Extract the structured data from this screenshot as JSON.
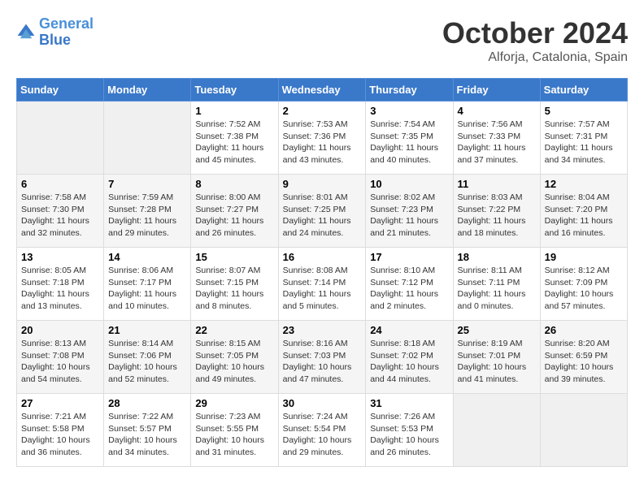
{
  "header": {
    "logo_general": "General",
    "logo_blue": "Blue",
    "month": "October 2024",
    "location": "Alforja, Catalonia, Spain"
  },
  "days_of_week": [
    "Sunday",
    "Monday",
    "Tuesday",
    "Wednesday",
    "Thursday",
    "Friday",
    "Saturday"
  ],
  "weeks": [
    [
      {
        "day": "",
        "sunrise": "",
        "sunset": "",
        "daylight": ""
      },
      {
        "day": "",
        "sunrise": "",
        "sunset": "",
        "daylight": ""
      },
      {
        "day": "1",
        "sunrise": "Sunrise: 7:52 AM",
        "sunset": "Sunset: 7:38 PM",
        "daylight": "Daylight: 11 hours and 45 minutes."
      },
      {
        "day": "2",
        "sunrise": "Sunrise: 7:53 AM",
        "sunset": "Sunset: 7:36 PM",
        "daylight": "Daylight: 11 hours and 43 minutes."
      },
      {
        "day": "3",
        "sunrise": "Sunrise: 7:54 AM",
        "sunset": "Sunset: 7:35 PM",
        "daylight": "Daylight: 11 hours and 40 minutes."
      },
      {
        "day": "4",
        "sunrise": "Sunrise: 7:56 AM",
        "sunset": "Sunset: 7:33 PM",
        "daylight": "Daylight: 11 hours and 37 minutes."
      },
      {
        "day": "5",
        "sunrise": "Sunrise: 7:57 AM",
        "sunset": "Sunset: 7:31 PM",
        "daylight": "Daylight: 11 hours and 34 minutes."
      }
    ],
    [
      {
        "day": "6",
        "sunrise": "Sunrise: 7:58 AM",
        "sunset": "Sunset: 7:30 PM",
        "daylight": "Daylight: 11 hours and 32 minutes."
      },
      {
        "day": "7",
        "sunrise": "Sunrise: 7:59 AM",
        "sunset": "Sunset: 7:28 PM",
        "daylight": "Daylight: 11 hours and 29 minutes."
      },
      {
        "day": "8",
        "sunrise": "Sunrise: 8:00 AM",
        "sunset": "Sunset: 7:27 PM",
        "daylight": "Daylight: 11 hours and 26 minutes."
      },
      {
        "day": "9",
        "sunrise": "Sunrise: 8:01 AM",
        "sunset": "Sunset: 7:25 PM",
        "daylight": "Daylight: 11 hours and 24 minutes."
      },
      {
        "day": "10",
        "sunrise": "Sunrise: 8:02 AM",
        "sunset": "Sunset: 7:23 PM",
        "daylight": "Daylight: 11 hours and 21 minutes."
      },
      {
        "day": "11",
        "sunrise": "Sunrise: 8:03 AM",
        "sunset": "Sunset: 7:22 PM",
        "daylight": "Daylight: 11 hours and 18 minutes."
      },
      {
        "day": "12",
        "sunrise": "Sunrise: 8:04 AM",
        "sunset": "Sunset: 7:20 PM",
        "daylight": "Daylight: 11 hours and 16 minutes."
      }
    ],
    [
      {
        "day": "13",
        "sunrise": "Sunrise: 8:05 AM",
        "sunset": "Sunset: 7:18 PM",
        "daylight": "Daylight: 11 hours and 13 minutes."
      },
      {
        "day": "14",
        "sunrise": "Sunrise: 8:06 AM",
        "sunset": "Sunset: 7:17 PM",
        "daylight": "Daylight: 11 hours and 10 minutes."
      },
      {
        "day": "15",
        "sunrise": "Sunrise: 8:07 AM",
        "sunset": "Sunset: 7:15 PM",
        "daylight": "Daylight: 11 hours and 8 minutes."
      },
      {
        "day": "16",
        "sunrise": "Sunrise: 8:08 AM",
        "sunset": "Sunset: 7:14 PM",
        "daylight": "Daylight: 11 hours and 5 minutes."
      },
      {
        "day": "17",
        "sunrise": "Sunrise: 8:10 AM",
        "sunset": "Sunset: 7:12 PM",
        "daylight": "Daylight: 11 hours and 2 minutes."
      },
      {
        "day": "18",
        "sunrise": "Sunrise: 8:11 AM",
        "sunset": "Sunset: 7:11 PM",
        "daylight": "Daylight: 11 hours and 0 minutes."
      },
      {
        "day": "19",
        "sunrise": "Sunrise: 8:12 AM",
        "sunset": "Sunset: 7:09 PM",
        "daylight": "Daylight: 10 hours and 57 minutes."
      }
    ],
    [
      {
        "day": "20",
        "sunrise": "Sunrise: 8:13 AM",
        "sunset": "Sunset: 7:08 PM",
        "daylight": "Daylight: 10 hours and 54 minutes."
      },
      {
        "day": "21",
        "sunrise": "Sunrise: 8:14 AM",
        "sunset": "Sunset: 7:06 PM",
        "daylight": "Daylight: 10 hours and 52 minutes."
      },
      {
        "day": "22",
        "sunrise": "Sunrise: 8:15 AM",
        "sunset": "Sunset: 7:05 PM",
        "daylight": "Daylight: 10 hours and 49 minutes."
      },
      {
        "day": "23",
        "sunrise": "Sunrise: 8:16 AM",
        "sunset": "Sunset: 7:03 PM",
        "daylight": "Daylight: 10 hours and 47 minutes."
      },
      {
        "day": "24",
        "sunrise": "Sunrise: 8:18 AM",
        "sunset": "Sunset: 7:02 PM",
        "daylight": "Daylight: 10 hours and 44 minutes."
      },
      {
        "day": "25",
        "sunrise": "Sunrise: 8:19 AM",
        "sunset": "Sunset: 7:01 PM",
        "daylight": "Daylight: 10 hours and 41 minutes."
      },
      {
        "day": "26",
        "sunrise": "Sunrise: 8:20 AM",
        "sunset": "Sunset: 6:59 PM",
        "daylight": "Daylight: 10 hours and 39 minutes."
      }
    ],
    [
      {
        "day": "27",
        "sunrise": "Sunrise: 7:21 AM",
        "sunset": "Sunset: 5:58 PM",
        "daylight": "Daylight: 10 hours and 36 minutes."
      },
      {
        "day": "28",
        "sunrise": "Sunrise: 7:22 AM",
        "sunset": "Sunset: 5:57 PM",
        "daylight": "Daylight: 10 hours and 34 minutes."
      },
      {
        "day": "29",
        "sunrise": "Sunrise: 7:23 AM",
        "sunset": "Sunset: 5:55 PM",
        "daylight": "Daylight: 10 hours and 31 minutes."
      },
      {
        "day": "30",
        "sunrise": "Sunrise: 7:24 AM",
        "sunset": "Sunset: 5:54 PM",
        "daylight": "Daylight: 10 hours and 29 minutes."
      },
      {
        "day": "31",
        "sunrise": "Sunrise: 7:26 AM",
        "sunset": "Sunset: 5:53 PM",
        "daylight": "Daylight: 10 hours and 26 minutes."
      },
      {
        "day": "",
        "sunrise": "",
        "sunset": "",
        "daylight": ""
      },
      {
        "day": "",
        "sunrise": "",
        "sunset": "",
        "daylight": ""
      }
    ]
  ]
}
